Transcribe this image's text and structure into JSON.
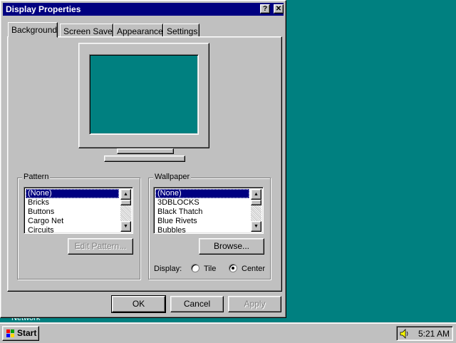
{
  "window": {
    "title": "Display Properties",
    "help_label": "?",
    "close_label": "✕"
  },
  "tabs": [
    {
      "label": "Background",
      "active": true
    },
    {
      "label": "Screen Saver",
      "active": false
    },
    {
      "label": "Appearance",
      "active": false
    },
    {
      "label": "Settings",
      "active": false
    }
  ],
  "pattern": {
    "label": "Pattern",
    "items": [
      "(None)",
      "Bricks",
      "Buttons",
      "Cargo Net",
      "Circuits"
    ],
    "selected": "(None)",
    "edit_button": "Edit Pattern..."
  },
  "wallpaper": {
    "label": "Wallpaper",
    "items": [
      "(None)",
      "3DBLOCKS",
      "Black Thatch",
      "Blue Rivets",
      "Bubbles"
    ],
    "selected": "(None)",
    "browse_button": "Browse...",
    "display_label": "Display:",
    "tile_label": "Tile",
    "center_label": "Center",
    "display_mode": "Center"
  },
  "footer": {
    "ok": "OK",
    "cancel": "Cancel",
    "apply": "Apply"
  },
  "taskbar": {
    "start_label": "Start",
    "clock": "5:21 AM",
    "behind_text": "Network"
  },
  "colors": {
    "desktop": "#008080",
    "titlebar": "#000080",
    "face": "#c0c0c0",
    "selection": "#000080"
  },
  "icons": [
    "help-icon",
    "close-icon",
    "start-logo-icon",
    "speaker-icon",
    "scroll-up-icon",
    "scroll-down-icon"
  ]
}
